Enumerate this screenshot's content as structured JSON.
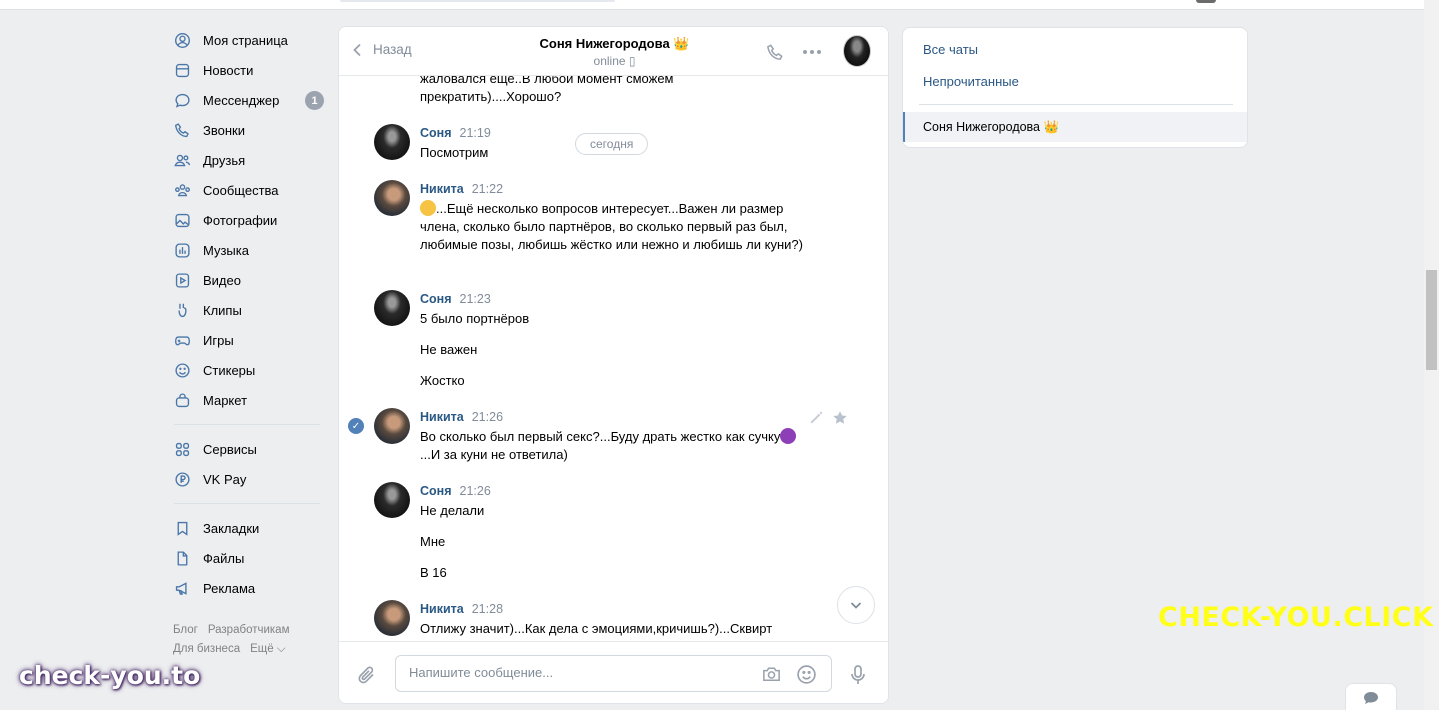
{
  "nav": {
    "items": [
      {
        "label": "Моя страница",
        "icon": "user-circle-icon"
      },
      {
        "label": "Новости",
        "icon": "news-icon"
      },
      {
        "label": "Мессенджер",
        "icon": "message-bubble-icon",
        "badge": "1"
      },
      {
        "label": "Звонки",
        "icon": "phone-icon"
      },
      {
        "label": "Друзья",
        "icon": "friends-icon"
      },
      {
        "label": "Сообщества",
        "icon": "communities-icon"
      },
      {
        "label": "Фотографии",
        "icon": "photo-icon"
      },
      {
        "label": "Музыка",
        "icon": "music-icon"
      },
      {
        "label": "Видео",
        "icon": "video-icon"
      },
      {
        "label": "Клипы",
        "icon": "clips-icon"
      },
      {
        "label": "Игры",
        "icon": "gamepad-icon"
      },
      {
        "label": "Стикеры",
        "icon": "smile-icon"
      },
      {
        "label": "Маркет",
        "icon": "bag-icon"
      }
    ],
    "services": [
      {
        "label": "Сервисы",
        "icon": "grid-icon"
      },
      {
        "label": "VK Pay",
        "icon": "ruble-icon"
      }
    ],
    "extras": [
      {
        "label": "Закладки",
        "icon": "bookmark-icon"
      },
      {
        "label": "Файлы",
        "icon": "file-icon"
      },
      {
        "label": "Реклама",
        "icon": "megaphone-icon"
      }
    ],
    "footer": {
      "blog": "Блог",
      "developers": "Разработчикам",
      "business": "Для бизнеса",
      "more": "Ещё ⌵"
    }
  },
  "chat": {
    "back_label": "Назад",
    "title": "Соня Нижегородова 👑",
    "status": "online ▯",
    "date_pill": "сегодня",
    "messages": [
      {
        "text": "жаловался еще..В любой момент сможем прекратить)....Хорошо?"
      },
      {
        "author": "Соня",
        "time": "21:19",
        "lines": [
          "Посмотрим"
        ]
      },
      {
        "author": "Никита",
        "time": "21:22",
        "lines": [
          "...Ещё несколько вопросов интересует...Важен ли размер члена, сколько было партнёров, во сколько первый раз был, любимые позы, любишь жёстко или нежно и любишь ли куни?)"
        ]
      },
      {
        "author": "Соня",
        "time": "21:23",
        "lines": [
          "5 было портнёров",
          "Не важен",
          "Жостко"
        ]
      },
      {
        "author": "Никита",
        "time": "21:26",
        "lines": [
          "Во сколько был первый секс?...Буду драть жестко как сучку",
          "...И за куни не ответила)"
        ]
      },
      {
        "author": "Соня",
        "time": "21:26",
        "lines": [
          "Не делали",
          "Мне",
          "В 16"
        ]
      },
      {
        "author": "Никита",
        "time": "21:28",
        "lines": [
          "Отлижу значит)...Как дела с эмоциями,кричишь?)...Сквирт"
        ]
      }
    ],
    "composer": {
      "placeholder": "Напишите сообщение..."
    }
  },
  "right_panel": {
    "all_chats": "Все чаты",
    "unread": "Непрочитанные",
    "active_chat": "Соня Нижегородова 👑"
  },
  "watermarks": {
    "right": "CHECK-YOU.CLICK",
    "left": "check-you.to"
  }
}
